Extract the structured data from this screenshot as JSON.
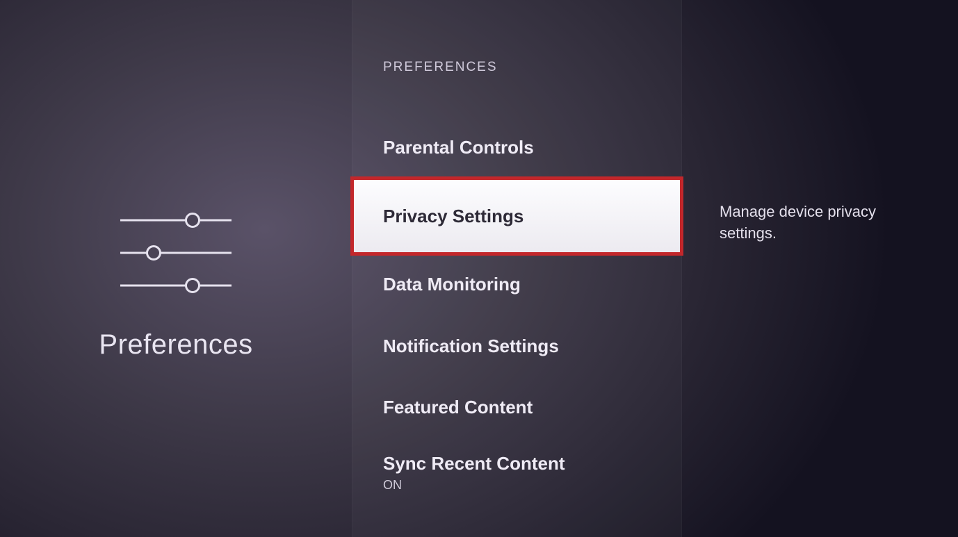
{
  "left": {
    "title": "Preferences"
  },
  "section": {
    "header": "PREFERENCES"
  },
  "menu": {
    "items": [
      {
        "label": "Parental Controls"
      },
      {
        "label": "Privacy Settings",
        "selected": true,
        "description": "Manage device privacy settings."
      },
      {
        "label": "Data Monitoring"
      },
      {
        "label": "Notification Settings"
      },
      {
        "label": "Featured Content"
      },
      {
        "label": "Sync Recent Content",
        "sub": "ON"
      }
    ]
  }
}
